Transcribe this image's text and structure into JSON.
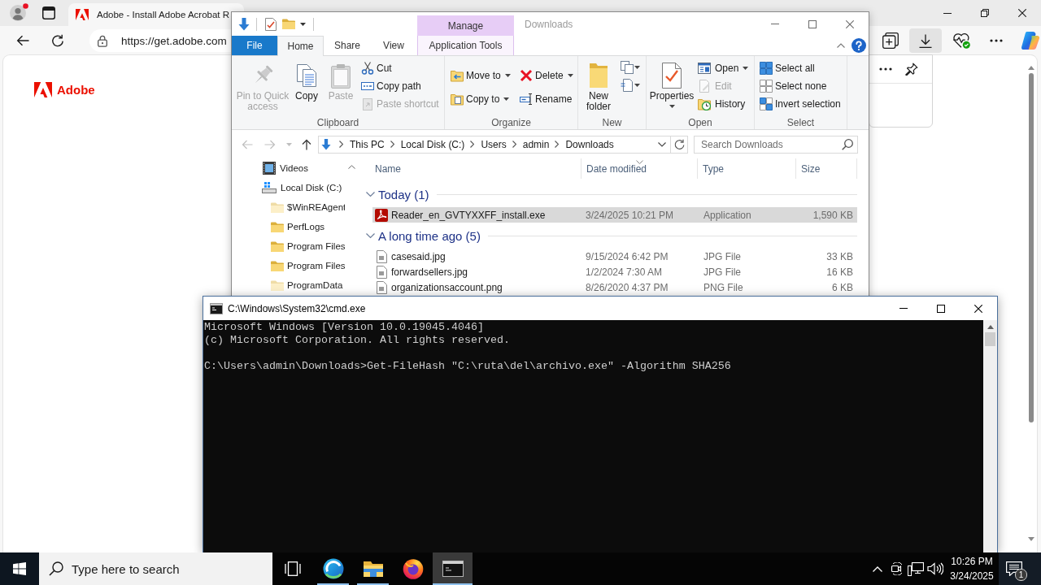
{
  "browser": {
    "tabs": [
      {
        "title": "Adobe - Install Adobe Acrobat R",
        "selected": true
      }
    ],
    "url": "https://get.adobe.com",
    "page": {
      "logo_text": "Adobe"
    }
  },
  "explorer": {
    "context_header": "Manage",
    "title": "Downloads",
    "tabs": [
      {
        "label": "File",
        "kind": "file",
        "selected": false
      },
      {
        "label": "Home",
        "kind": "normal",
        "selected": true
      },
      {
        "label": "Share",
        "kind": "normal",
        "selected": false
      },
      {
        "label": "View",
        "kind": "normal",
        "selected": false
      },
      {
        "label": "Application Tools",
        "kind": "contextual",
        "selected": false
      }
    ],
    "ribbon": [
      {
        "label": "Clipboard",
        "items": [
          {
            "kind": "large",
            "label": "Pin to Quick access",
            "disabled": true,
            "dropdown": false
          },
          {
            "kind": "large",
            "label": "Copy",
            "disabled": false,
            "dropdown": false
          },
          {
            "kind": "large",
            "label": "Paste",
            "disabled": true,
            "dropdown": false
          },
          {
            "kind": "small",
            "label": "Cut",
            "disabled": false,
            "dropdown": false
          },
          {
            "kind": "small",
            "label": "Copy path",
            "disabled": false,
            "dropdown": false
          },
          {
            "kind": "small",
            "label": "Paste shortcut",
            "disabled": true,
            "dropdown": false
          }
        ]
      },
      {
        "label": "Organize",
        "items": [
          {
            "kind": "small",
            "label": "Move to",
            "disabled": false,
            "dropdown": true
          },
          {
            "kind": "small",
            "label": "Copy to",
            "disabled": false,
            "dropdown": true
          },
          {
            "kind": "small",
            "label": "Delete",
            "disabled": false,
            "dropdown": true
          },
          {
            "kind": "small",
            "label": "Rename",
            "disabled": false,
            "dropdown": false
          }
        ]
      },
      {
        "label": "New",
        "items": [
          {
            "kind": "large",
            "label": "New folder",
            "disabled": false,
            "dropdown": false
          },
          {
            "kind": "icon",
            "disabled": false,
            "dropdown": true
          },
          {
            "kind": "icon",
            "disabled": false,
            "dropdown": true
          }
        ]
      },
      {
        "label": "Open",
        "items": [
          {
            "kind": "large",
            "label": "Properties",
            "disabled": false,
            "dropdown": true
          },
          {
            "kind": "small",
            "label": "Open",
            "disabled": false,
            "dropdown": true
          },
          {
            "kind": "small",
            "label": "Edit",
            "disabled": true,
            "dropdown": false
          },
          {
            "kind": "small",
            "label": "History",
            "disabled": false,
            "dropdown": false
          }
        ]
      },
      {
        "label": "Select",
        "items": [
          {
            "kind": "small",
            "label": "Select all",
            "disabled": false,
            "dropdown": false
          },
          {
            "kind": "small",
            "label": "Select none",
            "disabled": false,
            "dropdown": false
          },
          {
            "kind": "small",
            "label": "Invert selection",
            "disabled": false,
            "dropdown": false
          }
        ]
      }
    ],
    "nav_buttons": [
      {
        "kind": "back",
        "disabled": true
      },
      {
        "kind": "forward",
        "disabled": true
      },
      {
        "kind": "recent",
        "disabled": true
      },
      {
        "kind": "up",
        "disabled": false
      }
    ],
    "address": [
      "This PC",
      "Local Disk (C:)",
      "Users",
      "admin",
      "Downloads"
    ],
    "search": {
      "placeholder": "Search Downloads"
    },
    "nav_tree": [
      {
        "label": "Videos",
        "kind": "videos"
      },
      {
        "label": "Local Disk (C:)",
        "kind": "drive",
        "children": [
          {
            "label": "$WinREAgent",
            "kind": "folder",
            "hidden": true
          },
          {
            "label": "PerfLogs",
            "kind": "folder",
            "hidden": false
          },
          {
            "label": "Program Files",
            "kind": "folder",
            "hidden": false
          },
          {
            "label": "Program Files",
            "kind": "folder",
            "hidden": false
          },
          {
            "label": "ProgramData",
            "kind": "folder",
            "hidden": true
          }
        ]
      }
    ],
    "columns": [
      {
        "label": "Name",
        "sorted": false
      },
      {
        "label": "Date modified",
        "sorted": true
      },
      {
        "label": "Type",
        "sorted": false
      },
      {
        "label": "Size",
        "sorted": false
      }
    ],
    "groups": [
      {
        "label": "Today (1)",
        "expanded": true,
        "rows": [
          {
            "kind": "application",
            "name": "Reader_en_GVTYXXFF_install.exe",
            "modified": "3/24/2025 10:21 PM",
            "type": "Application",
            "size": "1,590 KB",
            "selected": true
          }
        ]
      },
      {
        "label": "A long time ago (5)",
        "expanded": true,
        "rows": [
          {
            "kind": "image",
            "name": "casesaid.jpg",
            "modified": "9/15/2024 6:42 PM",
            "type": "JPG File",
            "size": "33 KB",
            "selected": false
          },
          {
            "kind": "image",
            "name": "forwardsellers.jpg",
            "modified": "1/2/2024 7:30 AM",
            "type": "JPG File",
            "size": "16 KB",
            "selected": false
          },
          {
            "kind": "image",
            "name": "organizationsaccount.png",
            "modified": "8/26/2020 4:37 PM",
            "type": "PNG File",
            "size": "6 KB",
            "selected": false
          }
        ]
      }
    ]
  },
  "cmd": {
    "title": "C:\\Windows\\System32\\cmd.exe",
    "blocks": [
      [
        "Microsoft Windows [Version 10.0.19045.4046]",
        "(c) Microsoft Corporation. All rights reserved."
      ],
      [
        "C:\\Users\\admin\\Downloads>Get-FileHash \"C:\\ruta\\del\\archivo.exe\" -Algorithm SHA256"
      ]
    ]
  },
  "taskbar": {
    "search": {
      "placeholder": "Type here to search"
    },
    "apps": [
      {
        "kind": "edge",
        "running": true,
        "active": false
      },
      {
        "kind": "explorer",
        "running": true,
        "active": false
      },
      {
        "kind": "firefox",
        "running": false,
        "active": false
      },
      {
        "kind": "terminal",
        "running": true,
        "active": true
      }
    ],
    "clock": {
      "time": "10:26 PM",
      "date": "3/24/2025"
    },
    "notifications": "1"
  }
}
